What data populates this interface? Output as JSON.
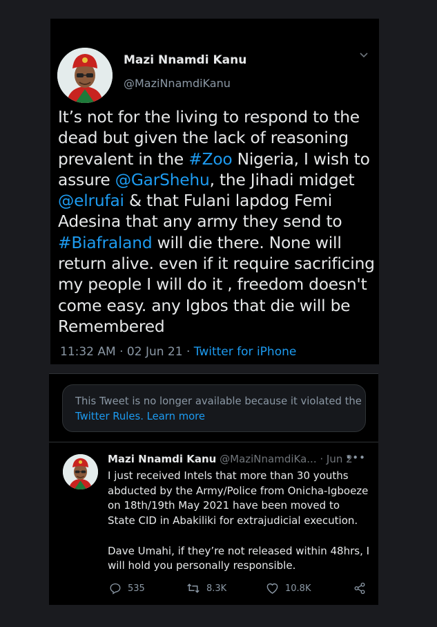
{
  "tweet1": {
    "author_name": "Mazi Nnamdi Kanu",
    "author_handle": "@MaziNnamdiKanu",
    "body_parts": {
      "p1": "It’s not for the living to respond to the dead but given the lack of reasoning prevalent in the ",
      "h1": "#Zoo",
      "p2": " Nigeria, I wish to assure ",
      "h2": "@GarShehu",
      "p3": ", the Jihadi midget ",
      "h3": "@elrufai",
      "p4": " & that Fulani lapdog Femi Adesina that any army they send to ",
      "h4": "#Biafraland",
      "p5": " will die there. None will return alive. even if it require sacrificing my people I will do it , freedom doesn't come easy. any Igbos that die will be Remembered"
    },
    "time": "11:32 AM",
    "date": "02 Jun 21",
    "source": "Twitter for iPhone"
  },
  "notice": {
    "text": "This Tweet is no longer available because it violated the",
    "rules_link": "Twitter Rules.",
    "learn_more": "Learn more"
  },
  "tweet2": {
    "author_name": "Mazi Nnamdi Kanu",
    "author_handle": "@MaziNnamdiKa...",
    "date": "Jun 2",
    "more": "•••",
    "body": "I just received Intels that more than 30 youths abducted by the Army/Police from Onicha-Igboeze on 18th/19th May 2021 have been moved to State CID in Abakiliki for extrajudicial execution.\n\nDave Umahi, if they’re not released within 48hrs, I will hold you personally responsible.",
    "replies": "535",
    "retweets": "8.3K",
    "likes": "10.8K"
  }
}
